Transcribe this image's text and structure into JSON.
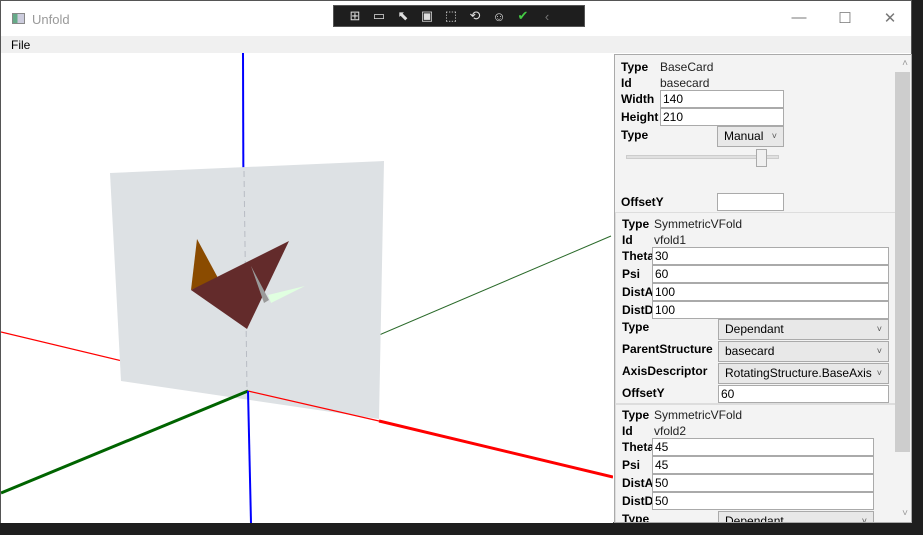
{
  "window": {
    "title": "Unfold",
    "minimize": "—",
    "maximize": "☐",
    "close": "✕"
  },
  "debug_toolbar": {
    "icons": [
      "live-visual-tree-icon",
      "camera-icon",
      "select-element-icon",
      "display-layout-adorners-icon",
      "track-focus-icon",
      "hot-reload-icon",
      "accessibility-icon",
      "check-icon",
      "collapse-icon"
    ]
  },
  "menu": {
    "file": "File"
  },
  "scene": {
    "colors": {
      "x_axis": "#ff0000",
      "y_axis": "#006400",
      "z_axis": "#0000ff",
      "card": "#dde1e4",
      "fold_main": "#632b2b",
      "fold_flap": "#8a4b00",
      "fold_small": "#e0ffe0"
    }
  },
  "panel": {
    "basecard": {
      "type_label": "Type",
      "type_value": "BaseCard",
      "id_label": "Id",
      "id_value": "basecard",
      "width_label": "Width",
      "width_value": "140",
      "height_label": "Height",
      "height_value": "210",
      "mode_label": "Type",
      "mode_value": "Manual",
      "slider_value": 0.83,
      "offset_label": "OffsetY",
      "offset_value": ""
    },
    "vfold1": {
      "type_label": "Type",
      "type_value": "SymmetricVFold",
      "id_label": "Id",
      "id_value": "vfold1",
      "theta_label": "Theta",
      "theta_value": "30",
      "psi_label": "Psi",
      "psi_value": "60",
      "dista_label": "DistA",
      "dista_value": "100",
      "distd_label": "DistD",
      "distd_value": "100",
      "mode_label": "Type",
      "mode_value": "Dependant",
      "parent_label": "ParentStructure",
      "parent_value": "basecard",
      "axis_label": "AxisDescriptor",
      "axis_value": "RotatingStructure.BaseAxis",
      "offset_label": "OffsetY",
      "offset_value": "60"
    },
    "vfold2": {
      "type_label": "Type",
      "type_value": "SymmetricVFold",
      "id_label": "Id",
      "id_value": "vfold2",
      "theta_label": "Theta",
      "theta_value": "45",
      "psi_label": "Psi",
      "psi_value": "45",
      "dista_label": "DistA",
      "dista_value": "50",
      "distd_label": "DistD",
      "distd_value": "50",
      "mode_label": "Type",
      "mode_value": "Dependant"
    }
  }
}
